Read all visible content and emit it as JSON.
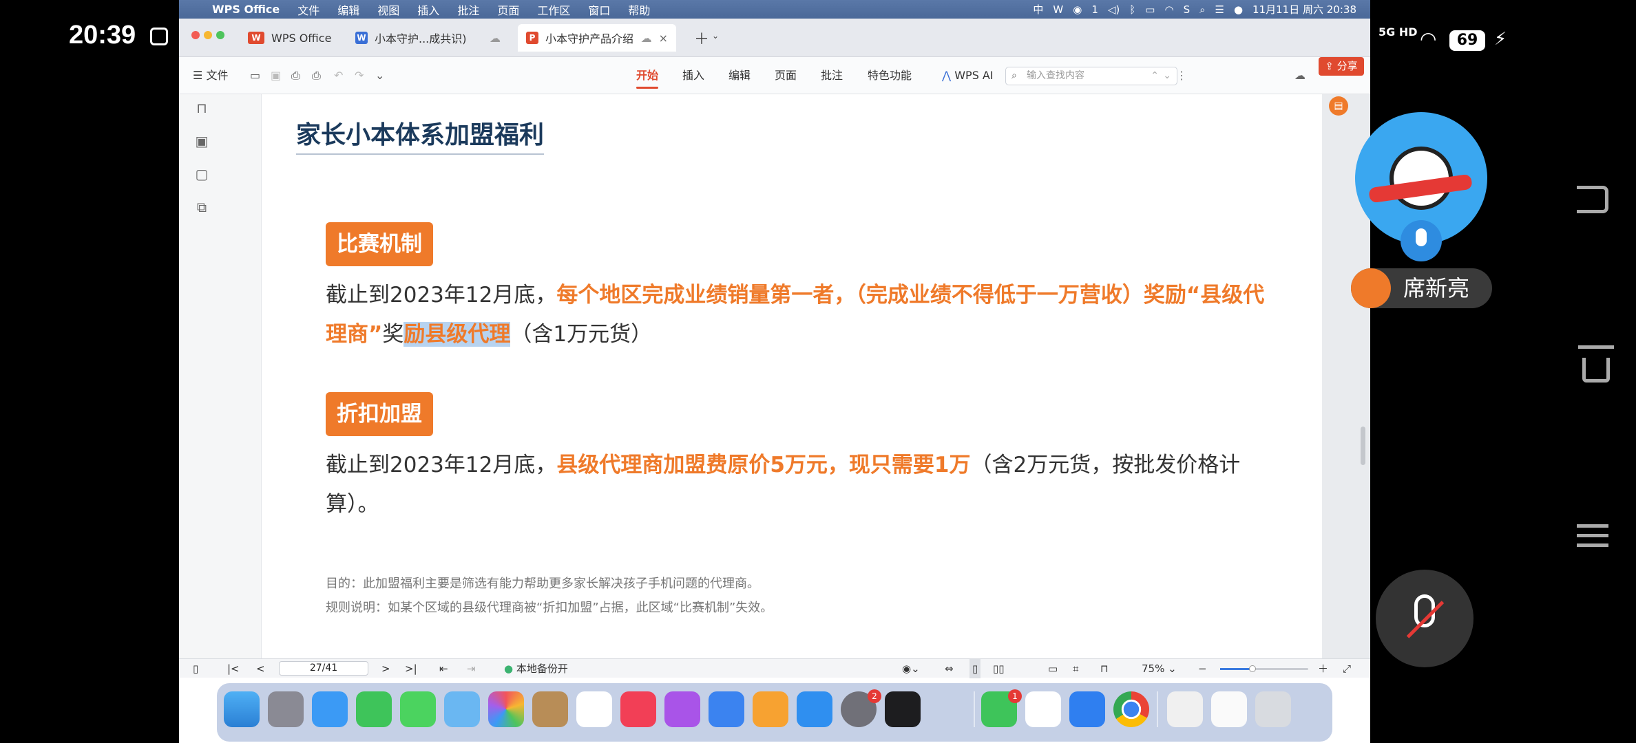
{
  "phone": {
    "time": "20:39",
    "network": "5G HD",
    "battery": "69"
  },
  "menubar": {
    "app_name": "WPS Office",
    "items": [
      "文件",
      "编辑",
      "视图",
      "插入",
      "批注",
      "页面",
      "工作区",
      "窗口",
      "帮助"
    ],
    "notif_count": "1",
    "datetime": "11月11日 周六 20:38"
  },
  "tabs": [
    {
      "label": "WPS Office"
    },
    {
      "label": "小本守护...成共识)"
    },
    {
      "label": "小本守护产品介绍"
    }
  ],
  "toolbar": {
    "file_label": "文件",
    "ribbon_tabs": [
      "开始",
      "插入",
      "编辑",
      "页面",
      "批注",
      "特色功能"
    ],
    "wps_ai": "WPS AI",
    "search_placeholder": "输入查找内容",
    "share_label": "分享"
  },
  "doc": {
    "title": "家长小本体系加盟福利",
    "section1": {
      "badge": "比赛机制",
      "p_plain1": "截止到2023年12月底，",
      "p_orange1": "每个地区完成业绩销量第一者，（完成业绩不得低于一万营收）奖励“县级代理商”",
      "p_plain2": "奖",
      "p_highlight": "励县级代理",
      "p_plain3": "（含1万元货）"
    },
    "section2": {
      "badge": "折扣加盟",
      "p_plain1": "截止到2023年12月底，",
      "p_orange1": "县级代理商加盟费原价5万元，现只需要1万",
      "p_plain2": "（含2万元货，按批发价格计算）。"
    },
    "note1": "目的：此加盟福利主要是筛选有能力帮助更多家长解决孩子手机问题的代理商。",
    "note2": "规则说明：如某个区域的县级代理商被“折扣加盟”占据，此区域“比赛机制”失效。"
  },
  "statusbar": {
    "page_indicator": "27/41",
    "backup_label": "本地备份开",
    "zoom": "75%"
  },
  "dock": {
    "badges": {
      "settings": "2",
      "wechat": "1"
    }
  },
  "meeting": {
    "participant_name": "席新亮"
  }
}
